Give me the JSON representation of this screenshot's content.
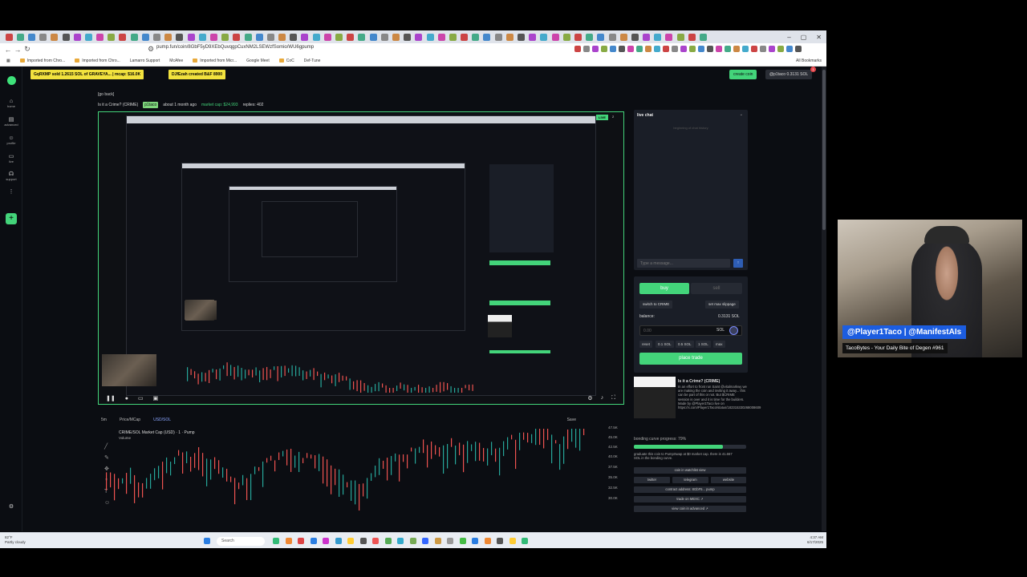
{
  "browser": {
    "url": "pump.fun/coin/8GbF5yD9XEbQuvqgpCuxNM2LSEWzfSomio/WU6gpump",
    "bookmarks": [
      "Imported from Chro...",
      "Imported from Chro...",
      "Lamarro Support",
      "McAfee",
      "Imported from Micr...",
      "Google Meet",
      "CoC",
      "Def-Tune"
    ],
    "all_bookmarks": "All Bookmarks"
  },
  "header": {
    "ticker1": "GqRXMP sold 1.2615 SOL of GRAVEYA... | mcap: $16.0K",
    "ticker2": "DJfEzah created B&F 8900",
    "create_coin": "create coin",
    "user": "@p1taco 0.3131 SOL",
    "notif_count": "1"
  },
  "nav": {
    "home": "home",
    "advanced": "advanced",
    "profile": "profile",
    "live": "live",
    "support": "support",
    "more": "more"
  },
  "coin": {
    "go_back": "[go back]",
    "name": "Is it a Crime? (CRIME)",
    "creator": "p1taco",
    "age": "about 1 month ago",
    "market_cap": "market cap: $24,993",
    "replies": "replies: 402",
    "full_title": "Is it a Crime? (CRIME)",
    "description": "In an effort to front run Saint @vitalmarkwy we are making the coin and inviting it away... this can be part of this or not. But $CRIME session is over and it is time for the builders. Made by @Player1Taco live on https://x.com/Player1Taco/status/182315330268008609"
  },
  "video": {
    "live_label": "LIVE",
    "viewers": "2",
    "cam_user": "p1taco"
  },
  "chat": {
    "title": "live chat",
    "beginning": "beginning of chat history",
    "placeholder": "Type a message...",
    "send": "↑"
  },
  "trade": {
    "buy": "buy",
    "sell": "sell",
    "switch": "switch to CRIME",
    "slippage": "set max slippage",
    "balance_label": "balance:",
    "balance_value": "0.3131 SOL",
    "amount_placeholder": "0.00",
    "unit": "SOL",
    "quick": [
      "reset",
      "0.1 SOL",
      "0.5 SOL",
      "1 SOL",
      "max"
    ],
    "place_trade": "place trade"
  },
  "bonding": {
    "label": "bonding curve progress: 79%",
    "progress": 0.79,
    "text": "graduate this coin to PumpSwap at $0 market cap. there is 41.667 SOL in the bonding curve."
  },
  "links": {
    "watchlist": "coin in watchlist  view",
    "twitter": "twitter",
    "telegram": "telegram",
    "website": "website",
    "contract": "contract address: 8GbF5... pump",
    "trade_mexc": "trade on MEXC ↗",
    "advanced": "view coin in advanced ↗"
  },
  "chart": {
    "toolbar": [
      "5m",
      "Price/MCap",
      "USD/SOL",
      "Save"
    ],
    "title": "CRIME/SOL Market Cap (USD) · 1 · Pump",
    "volume": "Volume",
    "yticks": [
      "47.5K",
      "45.0K",
      "42.5K",
      "40.0K",
      "37.5K",
      "35.0K",
      "32.5K",
      "30.0K"
    ]
  },
  "webcam": {
    "name": "@Player1Taco | @ManifestAIs",
    "subtitle": "TacoBytes - Your Daily Bite of Degen #961"
  },
  "taskbar": {
    "temp": "82°F",
    "weather": "Partly cloudy",
    "search": "Search",
    "time": "4:37 AM",
    "date": "6/17/2025"
  }
}
